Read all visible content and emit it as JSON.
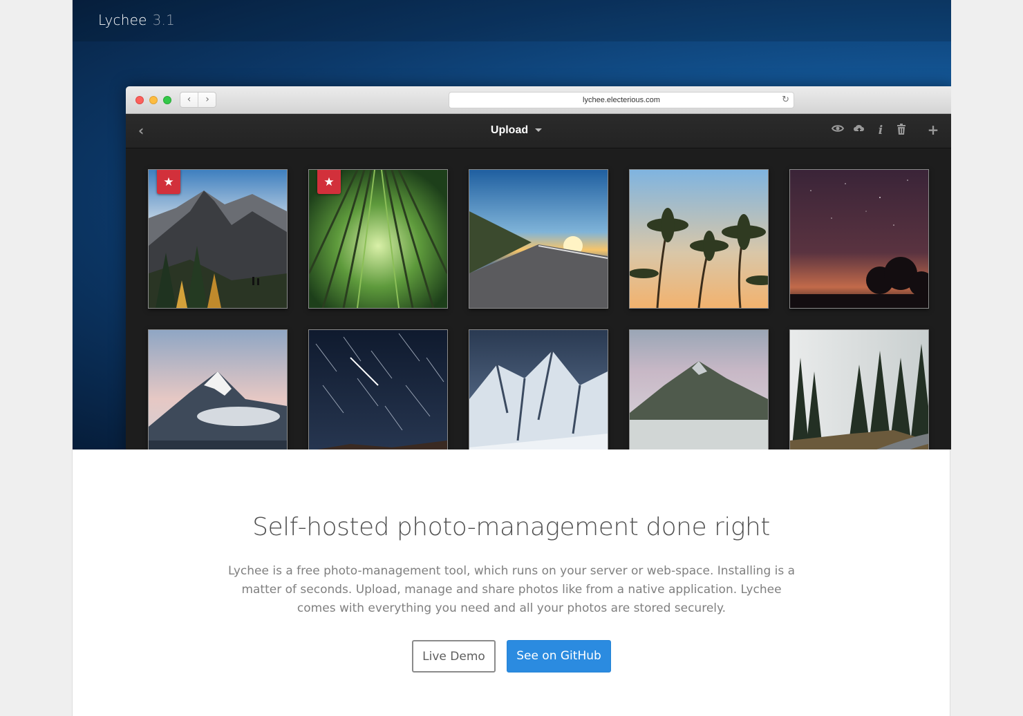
{
  "site": {
    "brand": "Lychee",
    "version": "3.1"
  },
  "browser": {
    "url": "lychee.electerious.com",
    "toolbar_title": "Upload",
    "icons": [
      "back-arrow-icon",
      "eye-icon",
      "cloud-upload-icon",
      "info-icon",
      "trash-icon",
      "plus-icon"
    ]
  },
  "photos": [
    {
      "subject": "mountain-hikers",
      "starred": true
    },
    {
      "subject": "bamboo-forest",
      "starred": true
    },
    {
      "subject": "coastal-road-sunset",
      "starred": false
    },
    {
      "subject": "palm-trees",
      "starred": false
    },
    {
      "subject": "night-sky-trees",
      "starred": false
    },
    {
      "subject": "snowy-peak-clouds",
      "starred": false
    },
    {
      "subject": "star-trails",
      "starred": false
    },
    {
      "subject": "icy-mountains",
      "starred": false
    },
    {
      "subject": "foggy-mountain",
      "starred": false
    },
    {
      "subject": "forest-road-fog",
      "starred": false
    }
  ],
  "content": {
    "headline": "Self-hosted photo-management done right",
    "description": "Lychee is a free photo-management tool, which runs on your server or web-space. Installing is a matter of seconds. Upload, manage and share photos like from a native application. Lychee comes with everything you need and all your photos are stored securely.",
    "demo_label": "Live Demo",
    "github_label": "See on GitHub"
  },
  "colors": {
    "accent": "#2b8be0",
    "star_badge": "#d2303b",
    "hero": "#135594"
  }
}
